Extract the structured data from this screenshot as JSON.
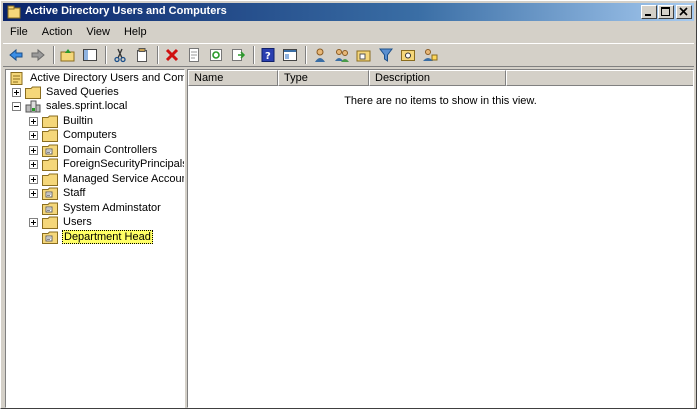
{
  "window": {
    "title": "Active Directory Users and Computers"
  },
  "menu": [
    "File",
    "Action",
    "View",
    "Help"
  ],
  "caption_buttons": [
    "minimize",
    "maximize",
    "close"
  ],
  "toolbar": {
    "buttons": [
      "back-icon",
      "forward-icon",
      "sep",
      "up-folder-icon",
      "show-hide-tree-icon",
      "sep",
      "cut-icon",
      "copy-icon",
      "sep",
      "delete-icon",
      "properties-icon",
      "refresh-icon",
      "export-list-icon",
      "sep",
      "help-icon",
      "mmc-console-icon",
      "sep",
      "new-user-icon",
      "new-group-icon",
      "new-ou-icon",
      "filter-icon",
      "find-icon",
      "add-to-group-icon"
    ]
  },
  "tree": {
    "root": "Active Directory Users and Comput",
    "saved_queries": "Saved Queries",
    "domain": "sales.sprint.local",
    "children": [
      {
        "label": "Builtin",
        "icon": "folder",
        "expander": true
      },
      {
        "label": "Computers",
        "icon": "folder",
        "expander": true
      },
      {
        "label": "Domain Controllers",
        "icon": "ou",
        "expander": true
      },
      {
        "label": "ForeignSecurityPrincipals",
        "icon": "folder",
        "expander": true
      },
      {
        "label": "Managed Service Accounts",
        "icon": "folder",
        "expander": true
      },
      {
        "label": "Staff",
        "icon": "ou",
        "expander": true
      },
      {
        "label": "System Adminstator",
        "icon": "ou",
        "expander": false
      },
      {
        "label": "Users",
        "icon": "folder",
        "expander": true
      },
      {
        "label": "Department Head",
        "icon": "ou",
        "expander": false,
        "selected": true
      }
    ]
  },
  "list": {
    "columns": [
      "Name",
      "Type",
      "Description"
    ],
    "empty_message": "There are no items to show in this view."
  },
  "colors": {
    "selection_highlight": "#ffff66",
    "titlebar": "#0a246a",
    "folder": "#f5d77a"
  }
}
